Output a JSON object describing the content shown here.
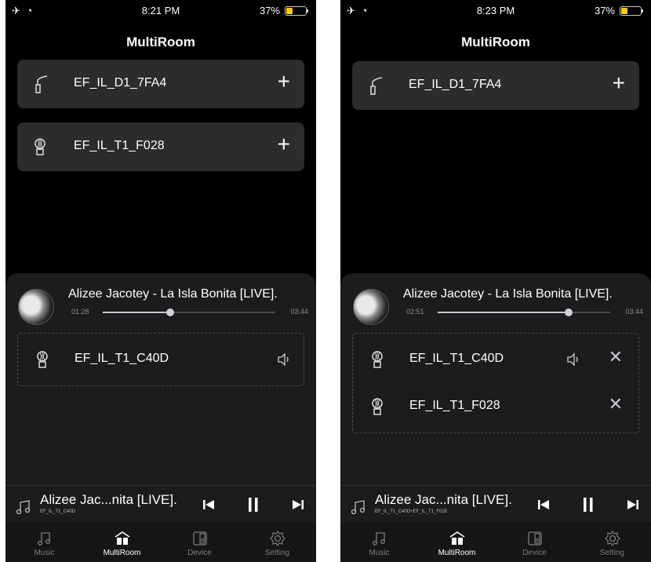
{
  "screens": [
    {
      "status": {
        "left": "✈ ◔",
        "time": "8:21 PM",
        "battery": "37%",
        "battery_level": 0.37
      },
      "title": "MultiRoom",
      "available_devices": [
        {
          "icon": "lamp-icon",
          "name": "EF_IL_D1_7FA4",
          "add": "+"
        },
        {
          "icon": "bulb-speaker-icon",
          "name": "EF_IL_T1_F028",
          "add": "+"
        }
      ],
      "now_playing": {
        "title": "Alizee Jacotey - La Isla Bonita [LIVE].",
        "elapsed": "01:28",
        "duration": "03:44",
        "progress": 0.39
      },
      "group": [
        {
          "icon": "bulb-speaker-icon",
          "name": "EF_IL_T1_C40D",
          "volume_icon": "speaker-icon",
          "remove": ""
        }
      ],
      "mini_player": {
        "title": "Alizee Jac...nita [LIVE].",
        "subtitle": "EF_IL_T1_C40D"
      },
      "tabs": [
        {
          "label": "Music",
          "icon": "music-note-icon",
          "active": false
        },
        {
          "label": "MultiRoom",
          "icon": "multiroom-icon",
          "active": true
        },
        {
          "label": "Device",
          "icon": "device-icon",
          "active": false
        },
        {
          "label": "Setting",
          "icon": "gear-icon",
          "active": false
        }
      ]
    },
    {
      "status": {
        "left": "✈ ◔",
        "time": "8:23 PM",
        "battery": "37%",
        "battery_level": 0.37
      },
      "title": "MultiRoom",
      "available_devices": [
        {
          "icon": "lamp-icon",
          "name": "EF_IL_D1_7FA4",
          "add": "+"
        }
      ],
      "now_playing": {
        "title": "Alizee Jacotey - La Isla Bonita [LIVE].",
        "elapsed": "02:51",
        "duration": "03:44",
        "progress": 0.76
      },
      "group": [
        {
          "icon": "bulb-speaker-icon",
          "name": "EF_IL_T1_C40D",
          "volume_icon": "speaker-icon",
          "remove": "✕"
        },
        {
          "icon": "bulb-speaker-icon",
          "name": "EF_IL_T1_F028",
          "volume_icon": "",
          "remove": "✕"
        }
      ],
      "mini_player": {
        "title": "Alizee Jac...nita [LIVE].",
        "subtitle": "EF_IL_T1_C40D+EF_IL_T1_F028"
      },
      "tabs": [
        {
          "label": "Music",
          "icon": "music-note-icon",
          "active": false
        },
        {
          "label": "MultiRoom",
          "icon": "multiroom-icon",
          "active": true
        },
        {
          "label": "Device",
          "icon": "device-icon",
          "active": false
        },
        {
          "label": "Setting",
          "icon": "gear-icon",
          "active": false
        }
      ]
    }
  ]
}
